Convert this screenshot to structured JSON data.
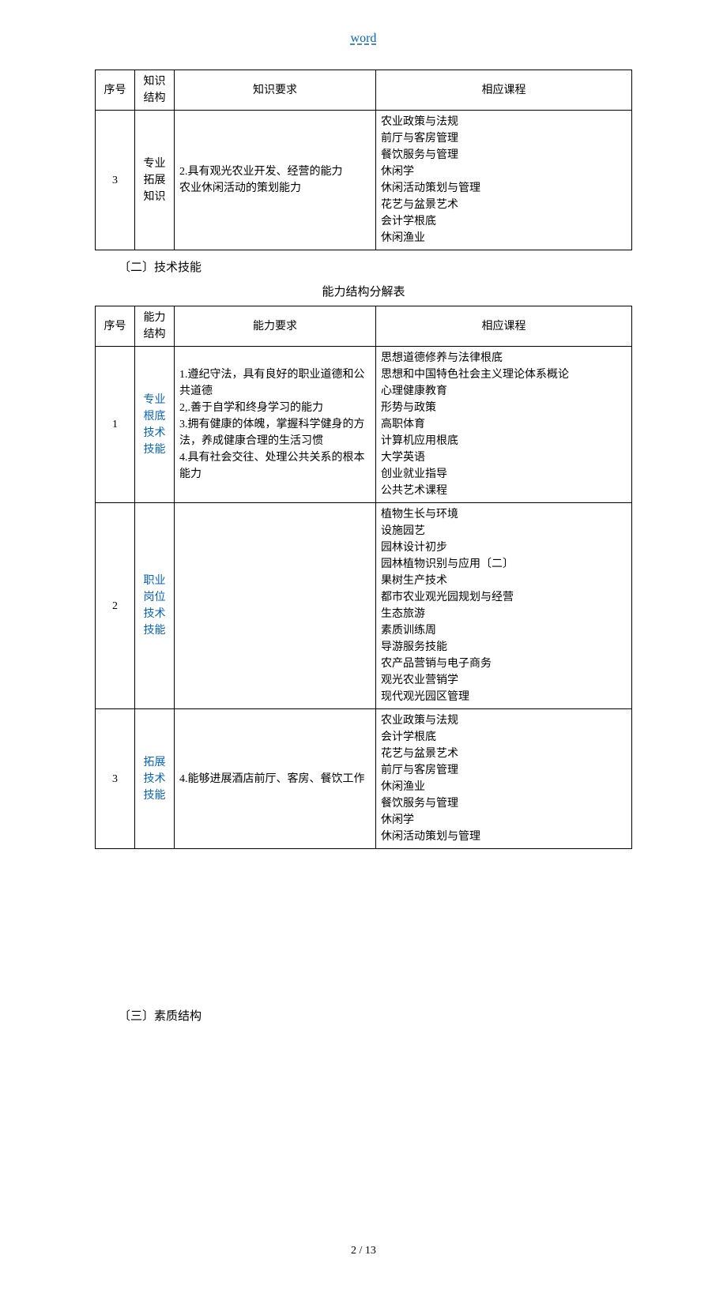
{
  "header": {
    "word_link": "word"
  },
  "table1": {
    "headers": {
      "num": "序号",
      "struct": "知识\n结构",
      "req": "知识要求",
      "course": "相应课程"
    },
    "rows": [
      {
        "num": "3",
        "struct": "专业\n拓展\n知识",
        "req": "2.具有观光农业开发、经营的能力\n农业休闲活动的策划能力",
        "course": "农业政策与法规\n前厅与客房管理\n餐饮服务与管理\n休闲学\n休闲活动策划与管理\n花艺与盆景艺术\n会计学根底\n休闲渔业"
      }
    ]
  },
  "section2": {
    "title": "〔二〕技术技能",
    "table_caption": "能力结构分解表"
  },
  "table2": {
    "headers": {
      "num": "序号",
      "struct": "能力\n结构",
      "req": "能力要求",
      "course": "相应课程"
    },
    "rows": [
      {
        "num": "1",
        "struct": "专业\n根底\n技术\n技能",
        "struct_link": true,
        "req": "1.遵纪守法，具有良好的职业道德和公共道德\n2,.善于自学和终身学习的能力\n3.拥有健康的体魄，掌握科学健身的方法，养成健康合理的生活习惯\n4.具有社会交往、处理公共关系的根本能力",
        "course": "思想道德修养与法律根底\n思想和中国特色社会主义理论体系概论\n心理健康教育\n形势与政策\n高职体育\n计算机应用根底\n大学英语\n创业就业指导\n公共艺术课程"
      },
      {
        "num": "2",
        "struct": "职业\n岗位\n技术\n技能",
        "struct_link": true,
        "req": "",
        "course": "植物生长与环境\n设施园艺\n园林设计初步\n园林植物识别与应用〔二〕\n果树生产技术\n都市农业观光园规划与经营\n生态旅游\n素质训练周\n导游服务技能\n农产品营销与电子商务\n观光农业营销学\n现代观光园区管理"
      },
      {
        "num": "3",
        "struct": "拓展\n技术\n技能",
        "struct_link": true,
        "req": "4.能够进展酒店前厅、客房、餐饮工作",
        "course": "农业政策与法规\n会计学根底\n花艺与盆景艺术\n前厅与客房管理\n休闲渔业\n餐饮服务与管理\n休闲学\n休闲活动策划与管理"
      }
    ]
  },
  "section3": {
    "title": "〔三〕素质结构"
  },
  "footer": {
    "page": "2 / 13"
  }
}
